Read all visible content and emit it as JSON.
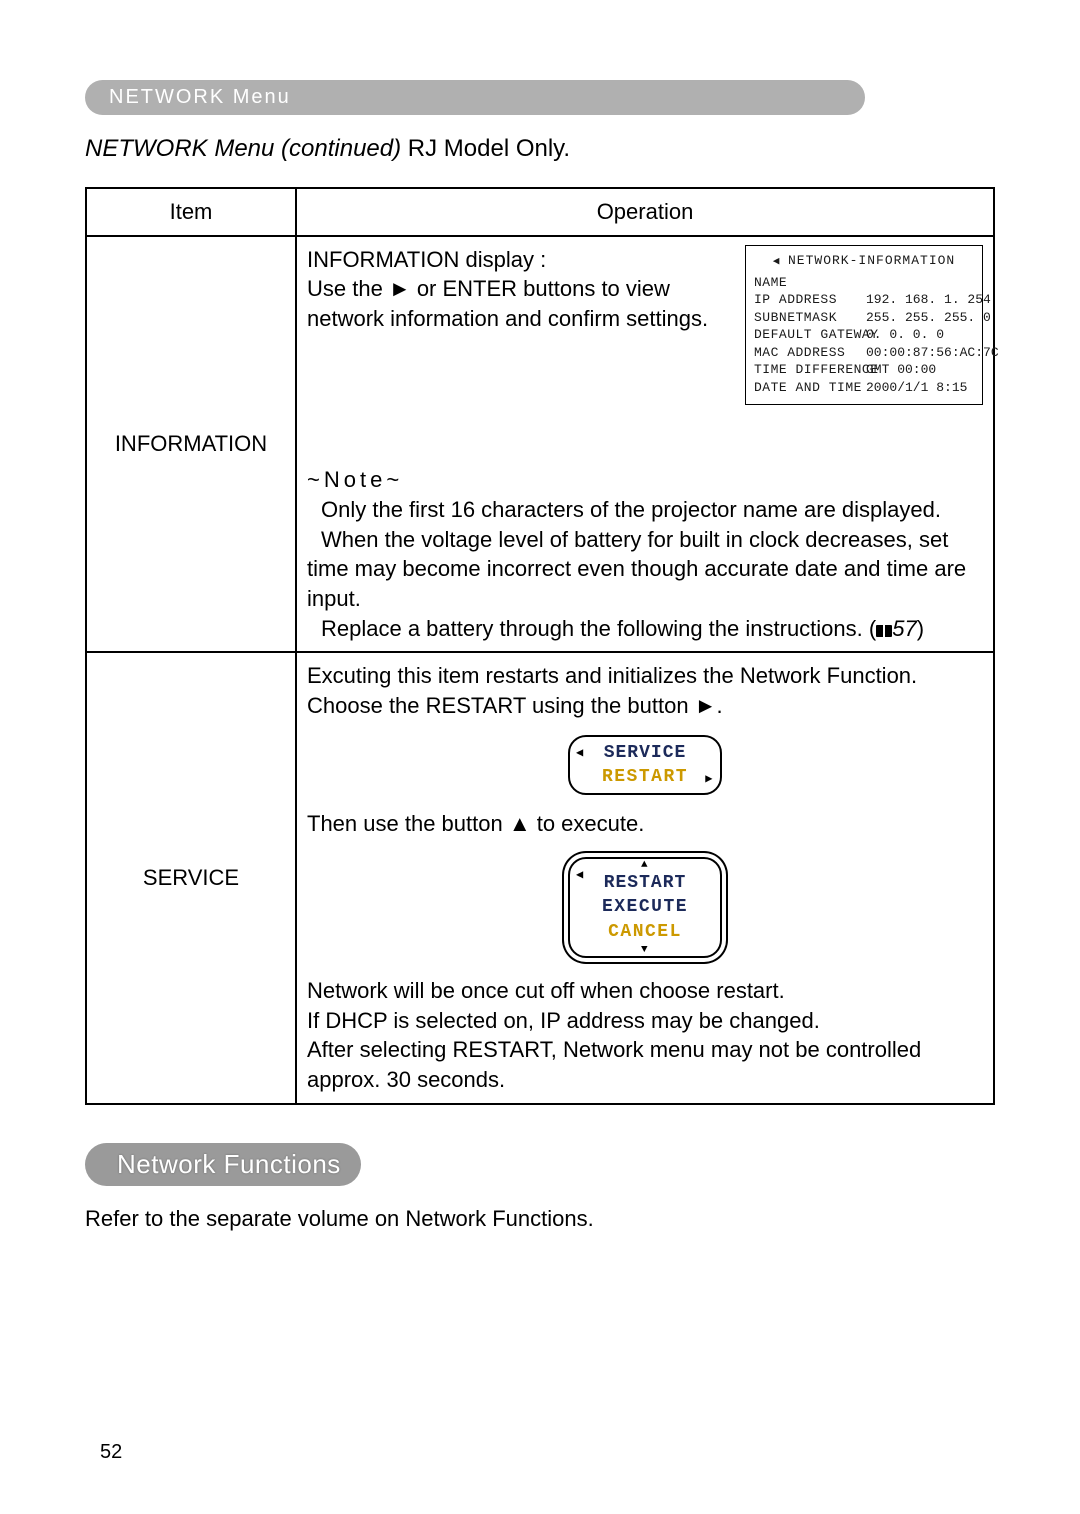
{
  "header": {
    "title": "NETWORK Menu"
  },
  "section_title": {
    "italic": "NETWORK Menu (continued)",
    "tail": " RJ Model Only."
  },
  "table": {
    "headers": {
      "item": "Item",
      "operation": "Operation"
    },
    "rows": [
      {
        "item": "INFORMATION",
        "op": {
          "lines1": [
            "INFORMATION display :",
            "Use the ► or ENTER buttons to view",
            "network information and confirm settings."
          ],
          "note_label": "~Note~",
          "notes": [
            "Only the first 16 characters of the projector name are displayed.",
            "When the voltage level of battery for built in clock decreases, set time may become incorrect even though accurate date and time are input.",
            "Replace a battery through the following the instructions."
          ],
          "page_ref": "57",
          "info_panel": {
            "title": "NETWORK-INFORMATION",
            "rows": [
              {
                "label": "NAME",
                "value": ""
              },
              {
                "label": "IP ADDRESS",
                "value": "192. 168. 1. 254"
              },
              {
                "label": "SUBNETMASK",
                "value": "255. 255. 255. 0"
              },
              {
                "label": "DEFAULT GATEWAY",
                "value": "0. 0. 0. 0"
              },
              {
                "label": "MAC ADDRESS",
                "value": "00:00:87:56:AC:7C"
              },
              {
                "label": "TIME DIFFERENCE",
                "value": "GMT 00:00"
              },
              {
                "label": "DATE AND TIME",
                "value": "2000/1/1  8:15"
              }
            ]
          }
        }
      },
      {
        "item": "SERVICE",
        "op": {
          "p1": "Excuting this item restarts and initializes the Network Function.",
          "p2": "Choose the RESTART using the button ►.",
          "osd1": {
            "line1": "SERVICE",
            "line2": "RESTART"
          },
          "p3": "Then use the button ▲ to execute.",
          "osd2": {
            "line1": "RESTART",
            "line2": "EXECUTE",
            "line3": "CANCEL"
          },
          "p4": [
            "Network will be once cut off when choose restart.",
            "If DHCP is selected on, IP address may be changed.",
            "After selecting RESTART, Network menu may not be controlled approx. 30 seconds."
          ]
        }
      }
    ]
  },
  "functions_pill": "Network Functions",
  "functions_refer": "Refer to the separate volume on Network Functions.",
  "page_number": "52"
}
